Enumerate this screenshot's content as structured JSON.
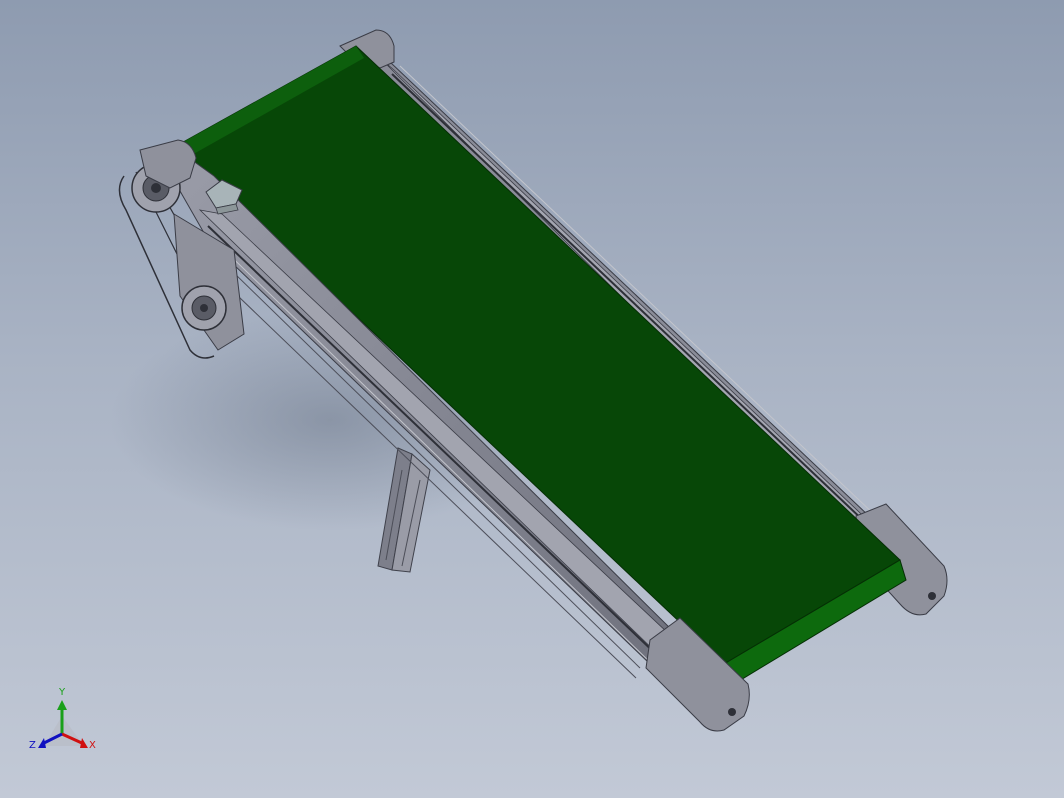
{
  "triad": {
    "y_label": "Y",
    "x_label": "X",
    "z_label": "Z",
    "y_color": "#1aa01a",
    "x_color": "#d01010",
    "z_color": "#1010c0"
  },
  "colors": {
    "background_top": "#8e9bb0",
    "background_bottom": "#c2c9d6",
    "belt": "#074707",
    "belt_edge": "#0d5f0d",
    "frame": "#8b8d9a",
    "frame_dark": "#5c5e6a"
  }
}
